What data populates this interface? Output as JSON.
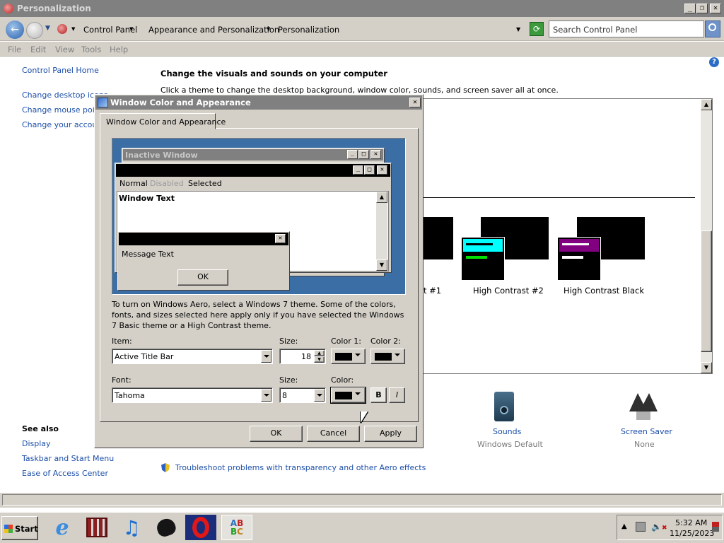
{
  "window": {
    "title": "Personalization"
  },
  "address": {
    "crumbs": [
      "Control Panel",
      "Appearance and Personalization",
      "Personalization"
    ]
  },
  "search": {
    "placeholder": "Search Control Panel"
  },
  "menu": [
    "File",
    "Edit",
    "View",
    "Tools",
    "Help"
  ],
  "sidebar": {
    "home": "Control Panel Home",
    "items": [
      "Change desktop icons",
      "Change mouse pointers",
      "Change your account picture"
    ],
    "see_also_title": "See also",
    "see_also": [
      "Display",
      "Taskbar and Start Menu",
      "Ease of Access Center"
    ]
  },
  "main": {
    "heading": "Change the visuals and sounds on your computer",
    "subheading": "Click a theme to change the desktop background, window color, sounds, and screen saver all at once.",
    "themes": [
      "st #1",
      "High Contrast #2",
      "High Contrast Black"
    ],
    "bottom_items": [
      {
        "label": "Sounds",
        "sub": "Windows Default"
      },
      {
        "label": "Screen Saver",
        "sub": "None"
      }
    ],
    "troubleshoot": "Troubleshoot problems with transparency and other Aero effects"
  },
  "dialog": {
    "title": "Window Color and Appearance",
    "tab": "Window Color and Appearance",
    "preview": {
      "inactive_title": "Inactive Window",
      "menu": [
        "Normal",
        "Disabled",
        "Selected"
      ],
      "window_text": "Window Text",
      "message_text": "Message Text",
      "ok": "OK"
    },
    "info": "To turn on Windows Aero, select a Windows 7 theme.  Some of the colors, fonts, and sizes selected here apply only if you have selected the Windows 7 Basic theme or a High Contrast theme.",
    "labels": {
      "item": "Item:",
      "size": "Size:",
      "color1": "Color 1:",
      "color2": "Color 2:",
      "font": "Font:",
      "size2": "Size:",
      "color": "Color:"
    },
    "values": {
      "item": "Active Title Bar",
      "item_size": "18",
      "font": "Tahoma",
      "font_size": "8",
      "bold": "B",
      "italic": "I"
    },
    "buttons": {
      "ok": "OK",
      "cancel": "Cancel",
      "apply": "Apply"
    }
  },
  "taskbar": {
    "start": "Start",
    "time": "5:32 AM",
    "date": "11/25/2023"
  }
}
